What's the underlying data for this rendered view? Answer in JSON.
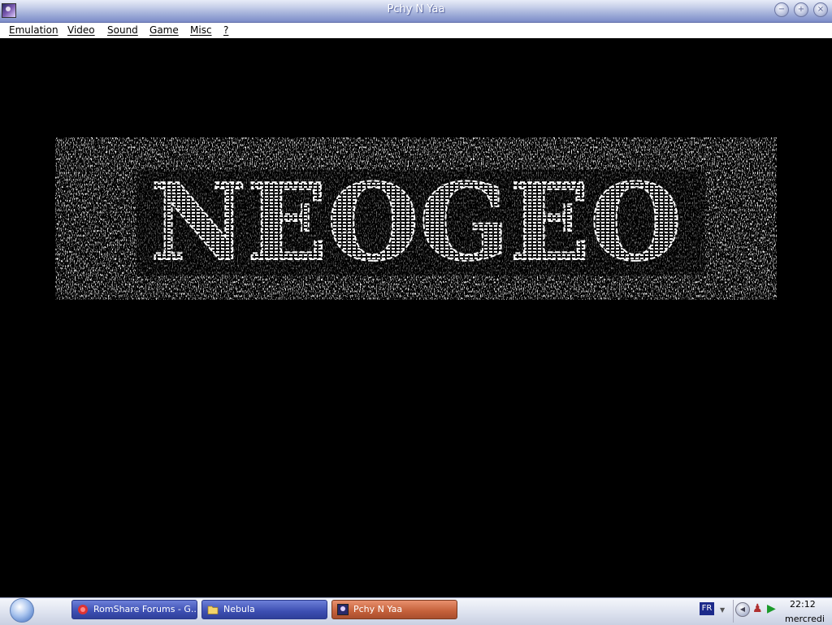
{
  "window": {
    "title": "Pchy N Yaa",
    "controls": [
      "minimize",
      "maximize",
      "close"
    ]
  },
  "menu": {
    "items": [
      {
        "first": "E",
        "rest": "mulation"
      },
      {
        "first": "V",
        "rest": "ideo"
      },
      {
        "first": "S",
        "rest": "ound"
      },
      {
        "first": "G",
        "rest": "ame"
      },
      {
        "first": "M",
        "rest": "isc"
      },
      {
        "first": "?",
        "rest": ""
      }
    ]
  },
  "game": {
    "logo_text": "NEOGEO",
    "background": "#000000",
    "logo_color": "#ffffff"
  },
  "taskbar": {
    "tasks": [
      {
        "label": "RomShare Forums - G...",
        "icon": "romshare-icon",
        "active": false
      },
      {
        "label": "Nebula",
        "icon": "folder-icon",
        "active": false
      },
      {
        "label": "Pchy N Yaa",
        "icon": "app-icon",
        "active": true
      }
    ],
    "tray": {
      "language": "FR",
      "time": "22:12",
      "day": "mercredi"
    }
  }
}
